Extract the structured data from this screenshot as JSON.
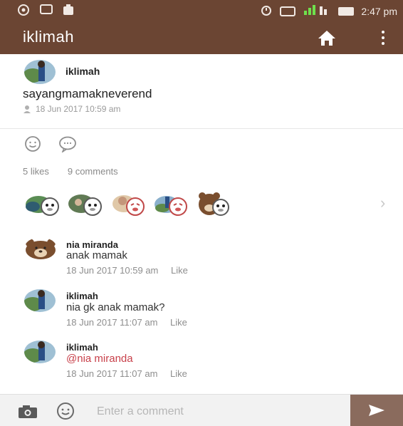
{
  "status_bar": {
    "time": "2:47 pm"
  },
  "app_bar": {
    "title": "iklimah"
  },
  "post": {
    "author": "iklimah",
    "text": "sayangmamakneverend",
    "timestamp": "18 Jun 2017 10:59 am"
  },
  "stats": {
    "likes": "5 likes",
    "comments": "9 comments"
  },
  "comments": [
    {
      "author": "nia miranda",
      "text": "anak mamak",
      "timestamp": "18 Jun 2017 10:59 am",
      "like_label": "Like"
    },
    {
      "author": "iklimah",
      "text": "nia gk anak mamak?",
      "timestamp": "18 Jun 2017 11:07 am",
      "like_label": "Like"
    },
    {
      "author": "iklimah",
      "text": "@nia miranda",
      "timestamp": "18 Jun 2017 11:07 am",
      "like_label": "Like"
    }
  ],
  "input": {
    "placeholder": "Enter a comment"
  },
  "colors": {
    "brand": "#6b4533",
    "send_button": "#8a6b5d",
    "mention": "#c8404a"
  },
  "icons": [
    "whatsapp-icon",
    "message-icon",
    "app-icon",
    "alarm-icon",
    "signal-icon",
    "battery-icon",
    "home-icon",
    "overflow-menu-icon",
    "smile-icon",
    "comment-icon",
    "chevron-right-icon",
    "camera-icon",
    "emoji-icon",
    "send-icon"
  ]
}
